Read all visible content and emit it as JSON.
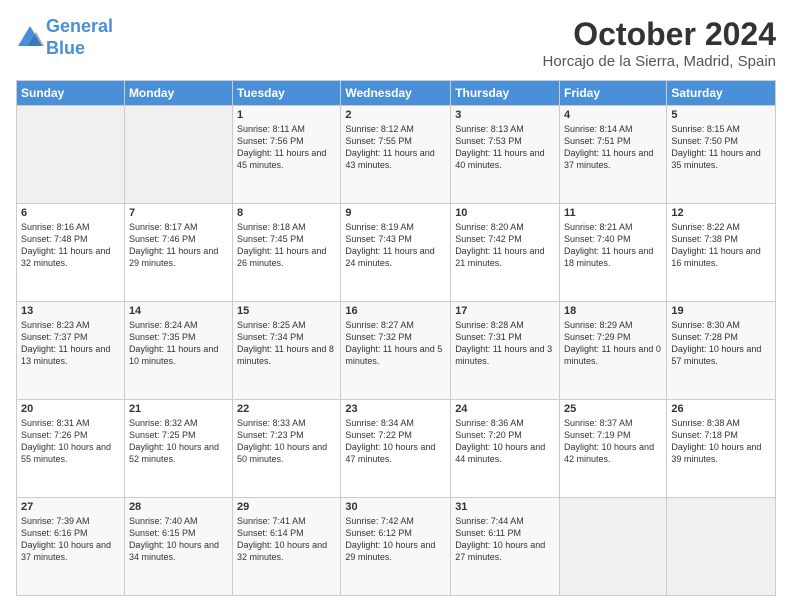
{
  "header": {
    "logo_line1": "General",
    "logo_line2": "Blue",
    "month": "October 2024",
    "location": "Horcajo de la Sierra, Madrid, Spain"
  },
  "days_of_week": [
    "Sunday",
    "Monday",
    "Tuesday",
    "Wednesday",
    "Thursday",
    "Friday",
    "Saturday"
  ],
  "weeks": [
    [
      {
        "num": "",
        "info": ""
      },
      {
        "num": "",
        "info": ""
      },
      {
        "num": "1",
        "info": "Sunrise: 8:11 AM\nSunset: 7:56 PM\nDaylight: 11 hours and 45 minutes."
      },
      {
        "num": "2",
        "info": "Sunrise: 8:12 AM\nSunset: 7:55 PM\nDaylight: 11 hours and 43 minutes."
      },
      {
        "num": "3",
        "info": "Sunrise: 8:13 AM\nSunset: 7:53 PM\nDaylight: 11 hours and 40 minutes."
      },
      {
        "num": "4",
        "info": "Sunrise: 8:14 AM\nSunset: 7:51 PM\nDaylight: 11 hours and 37 minutes."
      },
      {
        "num": "5",
        "info": "Sunrise: 8:15 AM\nSunset: 7:50 PM\nDaylight: 11 hours and 35 minutes."
      }
    ],
    [
      {
        "num": "6",
        "info": "Sunrise: 8:16 AM\nSunset: 7:48 PM\nDaylight: 11 hours and 32 minutes."
      },
      {
        "num": "7",
        "info": "Sunrise: 8:17 AM\nSunset: 7:46 PM\nDaylight: 11 hours and 29 minutes."
      },
      {
        "num": "8",
        "info": "Sunrise: 8:18 AM\nSunset: 7:45 PM\nDaylight: 11 hours and 26 minutes."
      },
      {
        "num": "9",
        "info": "Sunrise: 8:19 AM\nSunset: 7:43 PM\nDaylight: 11 hours and 24 minutes."
      },
      {
        "num": "10",
        "info": "Sunrise: 8:20 AM\nSunset: 7:42 PM\nDaylight: 11 hours and 21 minutes."
      },
      {
        "num": "11",
        "info": "Sunrise: 8:21 AM\nSunset: 7:40 PM\nDaylight: 11 hours and 18 minutes."
      },
      {
        "num": "12",
        "info": "Sunrise: 8:22 AM\nSunset: 7:38 PM\nDaylight: 11 hours and 16 minutes."
      }
    ],
    [
      {
        "num": "13",
        "info": "Sunrise: 8:23 AM\nSunset: 7:37 PM\nDaylight: 11 hours and 13 minutes."
      },
      {
        "num": "14",
        "info": "Sunrise: 8:24 AM\nSunset: 7:35 PM\nDaylight: 11 hours and 10 minutes."
      },
      {
        "num": "15",
        "info": "Sunrise: 8:25 AM\nSunset: 7:34 PM\nDaylight: 11 hours and 8 minutes."
      },
      {
        "num": "16",
        "info": "Sunrise: 8:27 AM\nSunset: 7:32 PM\nDaylight: 11 hours and 5 minutes."
      },
      {
        "num": "17",
        "info": "Sunrise: 8:28 AM\nSunset: 7:31 PM\nDaylight: 11 hours and 3 minutes."
      },
      {
        "num": "18",
        "info": "Sunrise: 8:29 AM\nSunset: 7:29 PM\nDaylight: 11 hours and 0 minutes."
      },
      {
        "num": "19",
        "info": "Sunrise: 8:30 AM\nSunset: 7:28 PM\nDaylight: 10 hours and 57 minutes."
      }
    ],
    [
      {
        "num": "20",
        "info": "Sunrise: 8:31 AM\nSunset: 7:26 PM\nDaylight: 10 hours and 55 minutes."
      },
      {
        "num": "21",
        "info": "Sunrise: 8:32 AM\nSunset: 7:25 PM\nDaylight: 10 hours and 52 minutes."
      },
      {
        "num": "22",
        "info": "Sunrise: 8:33 AM\nSunset: 7:23 PM\nDaylight: 10 hours and 50 minutes."
      },
      {
        "num": "23",
        "info": "Sunrise: 8:34 AM\nSunset: 7:22 PM\nDaylight: 10 hours and 47 minutes."
      },
      {
        "num": "24",
        "info": "Sunrise: 8:36 AM\nSunset: 7:20 PM\nDaylight: 10 hours and 44 minutes."
      },
      {
        "num": "25",
        "info": "Sunrise: 8:37 AM\nSunset: 7:19 PM\nDaylight: 10 hours and 42 minutes."
      },
      {
        "num": "26",
        "info": "Sunrise: 8:38 AM\nSunset: 7:18 PM\nDaylight: 10 hours and 39 minutes."
      }
    ],
    [
      {
        "num": "27",
        "info": "Sunrise: 7:39 AM\nSunset: 6:16 PM\nDaylight: 10 hours and 37 minutes."
      },
      {
        "num": "28",
        "info": "Sunrise: 7:40 AM\nSunset: 6:15 PM\nDaylight: 10 hours and 34 minutes."
      },
      {
        "num": "29",
        "info": "Sunrise: 7:41 AM\nSunset: 6:14 PM\nDaylight: 10 hours and 32 minutes."
      },
      {
        "num": "30",
        "info": "Sunrise: 7:42 AM\nSunset: 6:12 PM\nDaylight: 10 hours and 29 minutes."
      },
      {
        "num": "31",
        "info": "Sunrise: 7:44 AM\nSunset: 6:11 PM\nDaylight: 10 hours and 27 minutes."
      },
      {
        "num": "",
        "info": ""
      },
      {
        "num": "",
        "info": ""
      }
    ]
  ]
}
